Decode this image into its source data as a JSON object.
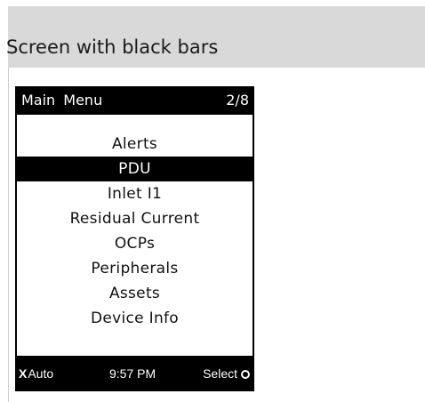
{
  "heading": "Screen with black bars",
  "device": {
    "top_bar": {
      "title": "Main Menu",
      "page": "2/8"
    },
    "menu": {
      "items": [
        {
          "label": "Alerts",
          "selected": false
        },
        {
          "label": "PDU",
          "selected": true
        },
        {
          "label": "Inlet I1",
          "selected": false
        },
        {
          "label": "Residual Current",
          "selected": false
        },
        {
          "label": "OCPs",
          "selected": false
        },
        {
          "label": "Peripherals",
          "selected": false
        },
        {
          "label": "Assets",
          "selected": false
        },
        {
          "label": "Device Info",
          "selected": false
        }
      ]
    },
    "bottom_bar": {
      "left_icon": "x-icon",
      "left_label": "Auto",
      "clock": "9:57 PM",
      "right_label": "Select",
      "right_icon": "circle-icon"
    }
  },
  "colors": {
    "header_band": "#d9d9d9",
    "bar": "#000000",
    "screen": "#ffffff"
  }
}
